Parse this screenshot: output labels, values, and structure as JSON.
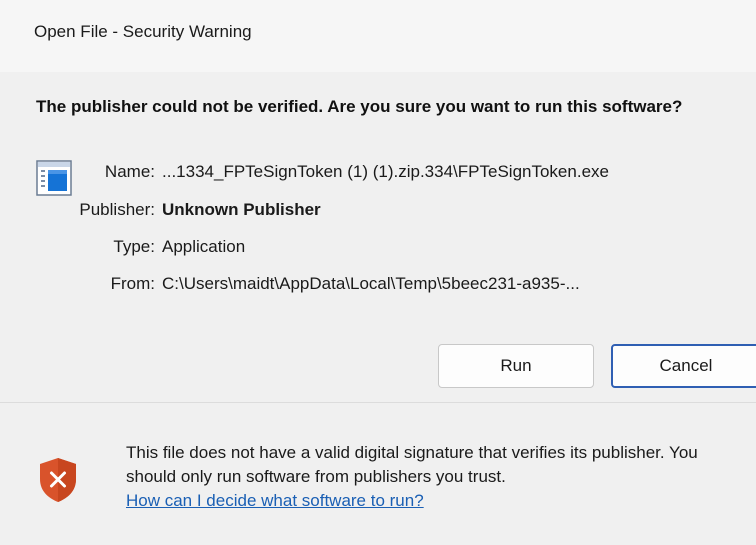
{
  "window": {
    "title": "Open File - Security Warning"
  },
  "main": {
    "headline": "The publisher could not be verified.  Are you sure you want to run this software?",
    "fields": [
      {
        "label": "Name:",
        "value": "...1334_FPTeSignToken (1) (1).zip.334\\FPTeSignToken.exe",
        "bold": false
      },
      {
        "label": "Publisher:",
        "value": "Unknown Publisher",
        "bold": true
      },
      {
        "label": "Type:",
        "value": "Application",
        "bold": false
      },
      {
        "label": "From:",
        "value": "C:\\Users\\maidt\\AppData\\Local\\Temp\\5beec231-a935-...",
        "bold": false
      }
    ],
    "icon": "application-icon"
  },
  "buttons": {
    "run_label": "Run",
    "cancel_label": "Cancel"
  },
  "footer": {
    "warning_text": "This file does not have a valid digital signature that verifies its publisher.  You should only run software from publishers you trust.",
    "help_link": "How can I decide what software to run?",
    "icon": "shield-warning-icon"
  },
  "colors": {
    "accent": "#2f5fb3",
    "link": "#1a5fb4",
    "shield": "#d9532b"
  }
}
